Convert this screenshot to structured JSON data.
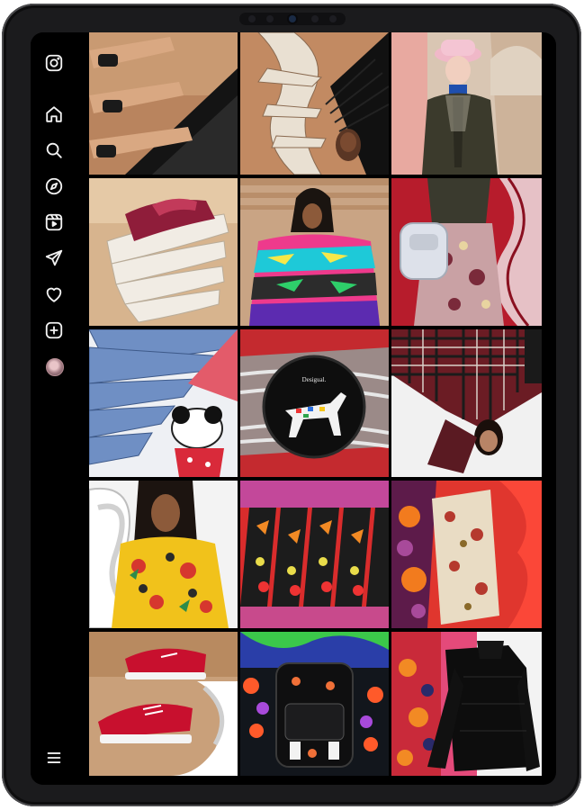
{
  "app": {
    "brand_icon": "instagram-logo-icon",
    "accent": "#000000"
  },
  "sidebar": {
    "items": [
      {
        "icon": "instagram-logo-icon",
        "name": "instagram"
      },
      {
        "icon": "home-icon",
        "name": "home"
      },
      {
        "icon": "search-icon",
        "name": "search"
      },
      {
        "icon": "explore-compass-icon",
        "name": "explore"
      },
      {
        "icon": "reels-icon",
        "name": "reels"
      },
      {
        "icon": "send-icon",
        "name": "messages"
      },
      {
        "icon": "heart-icon",
        "name": "notifications"
      },
      {
        "icon": "create-plus-icon",
        "name": "create"
      },
      {
        "icon": "avatar",
        "name": "profile"
      }
    ],
    "menu_icon": "hamburger-menu-icon"
  },
  "grid": {
    "posts": [
      {
        "subject": "sandals-legs-collage"
      },
      {
        "subject": "braided-hair-model-kaleidoscope"
      },
      {
        "subject": "model-pink-bucket-hat"
      },
      {
        "subject": "white-sneaker-wing"
      },
      {
        "subject": "model-colorful-knit-sweater"
      },
      {
        "subject": "model-floral-skirt-backpack"
      },
      {
        "subject": "denim-minnie-mouse-shirt"
      },
      {
        "subject": "dalmatian-round-bag",
        "label": "Desigual."
      },
      {
        "subject": "model-plaid-coat"
      },
      {
        "subject": "model-yellow-floral-dress"
      },
      {
        "subject": "floral-print-mirror-pattern"
      },
      {
        "subject": "floral-shirt-red-petals"
      },
      {
        "subject": "red-sneakers"
      },
      {
        "subject": "black-floral-backpack"
      },
      {
        "subject": "black-floral-sweater"
      }
    ]
  }
}
